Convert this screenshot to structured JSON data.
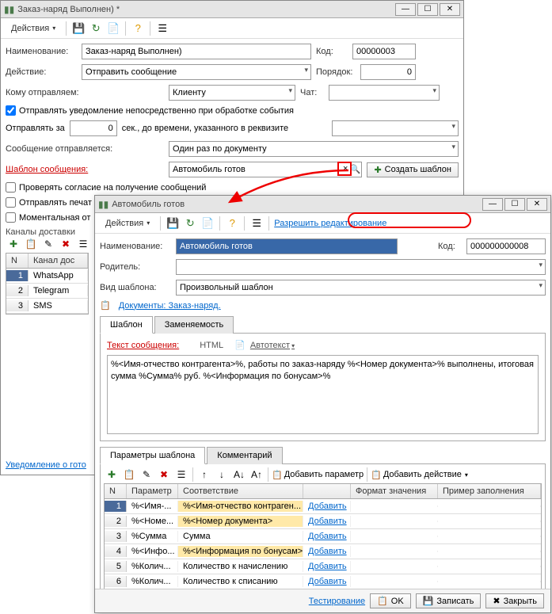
{
  "w1": {
    "title": "Заказ-наряд Выполнен) *",
    "actions": "Действия",
    "name_lbl": "Наименование:",
    "name_val": "Заказ-наряд Выполнен)",
    "code_lbl": "Код:",
    "code_val": "00000003",
    "action_lbl": "Действие:",
    "action_val": "Отправить сообщение",
    "order_lbl": "Порядок:",
    "order_val": "0",
    "recipient_lbl": "Кому отправляем:",
    "recipient_val": "Клиенту",
    "chat_lbl": "Чат:",
    "chat_val": "",
    "chk1": "Отправлять уведомление непосредственно при обработке события",
    "send_for": "Отправлять за",
    "send_for_val": "0",
    "send_for_suffix": "сек., до времени, указанного в реквизите",
    "msg_sent_lbl": "Сообщение отправляется:",
    "msg_sent_val": "Один раз по документу",
    "template_lbl": "Шаблон сообщения:",
    "template_val": "Автомобиль готов",
    "create_tpl": "Создать шаблон",
    "chk2": "Проверять согласие на получение сообщений",
    "chk3": "Отправлять печат",
    "chk4": "Моментальная от",
    "channels_lbl": "Каналы доставки",
    "ch_col": "Канал дос",
    "ch": [
      {
        "n": "1",
        "v": "WhatsApp"
      },
      {
        "n": "2",
        "v": "Telegram"
      },
      {
        "n": "3",
        "v": "SMS"
      }
    ],
    "footer_link": "Уведомление о гото"
  },
  "w2": {
    "title": "Автомобиль готов",
    "actions": "Действия",
    "allow_edit": "Разрешить редактирование",
    "name_lbl": "Наименование:",
    "name_val": "Автомобиль готов",
    "code_lbl": "Код:",
    "code_val": "000000000008",
    "parent_lbl": "Родитель:",
    "parent_val": "",
    "type_lbl": "Вид шаблона:",
    "type_val": "Произвольный шаблон",
    "docs": "Документы: Заказ-наряд.",
    "tab_tpl": "Шаблон",
    "tab_repl": "Заменяемость",
    "text_lbl": "Текст сообщения:",
    "html_btn": "HTML",
    "autotext": "Автотекст",
    "body": "%<Имя-отчество контрагента>%, работы по заказ-наряду %<Номер документа>% выполнены, итоговая сумма %Сумма% руб.   %<Информация по бонусам>%",
    "tab_params": "Параметры шаблона",
    "tab_comment": "Комментарий",
    "add_param": "Добавить параметр",
    "add_action": "Добавить действие",
    "cols": {
      "n": "N",
      "p": "Параметр",
      "s": "Соответствие",
      "f": "Формат значения",
      "e": "Пример заполнения"
    },
    "rows": [
      {
        "n": "1",
        "p": "%<Имя-...",
        "s": "%<Имя-отчество контраген...",
        "a": "Добавить",
        "y": true
      },
      {
        "n": "2",
        "p": "%<Номе...",
        "s": "%<Номер документа>",
        "a": "Добавить",
        "y": true
      },
      {
        "n": "3",
        "p": "%Сумма",
        "s": "Сумма",
        "a": "Добавить",
        "y": false
      },
      {
        "n": "4",
        "p": "%<Инфо...",
        "s": "%<Информация по бонусам>",
        "a": "Добавить",
        "y": true
      },
      {
        "n": "5",
        "p": "%Колич...",
        "s": "Количество к начислению",
        "a": "Добавить",
        "y": false
      },
      {
        "n": "6",
        "p": "%Колич...",
        "s": "Количество к списанию",
        "a": "Добавить",
        "y": false
      }
    ],
    "testing": "Тестирование",
    "ok": "OK",
    "save": "Записать",
    "close": "Закрыть"
  }
}
